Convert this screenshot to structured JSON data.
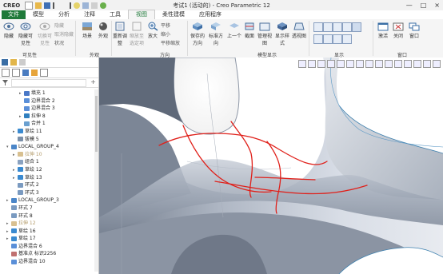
{
  "app": {
    "logo": "CREO",
    "window_title": "考试1 (活动的) - Creo Parametric 12",
    "win_buttons": [
      "—",
      "□",
      "×"
    ]
  },
  "tabs": [
    "文件",
    "模型",
    "分析",
    "注释",
    "工具",
    "视图",
    "柔性建模",
    "应用程序"
  ],
  "active_tab": "视图",
  "ribbon": {
    "visibility": {
      "btn_hide": "隐藏",
      "btn_show": "隐藏可见性",
      "btn_toggle": "切换可见性",
      "small": [
        "隐藏",
        "取消隐藏",
        "状况"
      ],
      "label": "可见性"
    },
    "appearance": {
      "btn_scene": "场景",
      "btn_appearance": "外观",
      "label": "外观"
    },
    "orientation": {
      "btn_refit": "重新调整",
      "btn_zoom_sel": "缩放至选定项",
      "btn_zoom": "放大",
      "small": [
        "平移",
        "缩小",
        "平移缩放"
      ],
      "label": "方向"
    },
    "model_display": {
      "btn_saved_orient": "保存的方向",
      "btn_standard_orient": "标准方向",
      "btn_prev": "上一个",
      "btn_section": "截面",
      "btn_manage_views": "管理视图",
      "btn_display_style": "显示样式",
      "btn_perspective": "透视图",
      "label": "模型显示"
    },
    "show": {
      "label": "显示"
    },
    "window": {
      "btn_activate": "激活",
      "btn_close": "关闭",
      "btn_windows": "窗口",
      "label": "窗口"
    }
  },
  "tree": [
    {
      "label": "填充 1",
      "indent": 3,
      "arrow": "▸",
      "icon": "#4a78c7",
      "dim": false
    },
    {
      "label": "边界混合 2",
      "indent": 3,
      "arrow": "",
      "icon": "#5a8fd8",
      "dim": false
    },
    {
      "label": "边界混合 3",
      "indent": 3,
      "arrow": "",
      "icon": "#5a8fd8",
      "dim": false
    },
    {
      "label": "拉伸 8",
      "indent": 3,
      "arrow": "▸",
      "icon": "#2f7fbf",
      "dim": false
    },
    {
      "label": "合并 1",
      "indent": 3,
      "arrow": "",
      "icon": "#6aa0d0",
      "dim": false
    },
    {
      "label": "草绘 11",
      "indent": 2,
      "arrow": "▸",
      "icon": "#3a8ad0",
      "dim": false
    },
    {
      "label": "拔模 5",
      "indent": 2,
      "arrow": "",
      "icon": "#7a8fa8",
      "dim": false
    },
    {
      "label": "LOCAL_GROUP_4",
      "indent": 1,
      "arrow": "▾",
      "icon": "#4b86c8",
      "dim": false
    },
    {
      "label": "拉伸 10",
      "indent": 2,
      "arrow": "▸",
      "icon": "#d8c090",
      "dim": true
    },
    {
      "label": "组合 1",
      "indent": 2,
      "arrow": "",
      "icon": "#8aa2c0",
      "dim": false
    },
    {
      "label": "草绘 12",
      "indent": 2,
      "arrow": "▸",
      "icon": "#3a8ad0",
      "dim": false
    },
    {
      "label": "草绘 13",
      "indent": 2,
      "arrow": "▸",
      "icon": "#3a8ad0",
      "dim": false
    },
    {
      "label": "环式 2",
      "indent": 2,
      "arrow": "",
      "icon": "#7a9ac0",
      "dim": false
    },
    {
      "label": "环式 3",
      "indent": 2,
      "arrow": "",
      "icon": "#7a9ac0",
      "dim": false
    },
    {
      "label": "LOCAL_GROUP_3",
      "indent": 1,
      "arrow": "▸",
      "icon": "#4b86c8",
      "dim": false
    },
    {
      "label": "环式 7",
      "indent": 1,
      "arrow": "",
      "icon": "#7a9ac0",
      "dim": false
    },
    {
      "label": "环式 8",
      "indent": 1,
      "arrow": "",
      "icon": "#7a9ac0",
      "dim": false
    },
    {
      "label": "拉伸 12",
      "indent": 1,
      "arrow": "▸",
      "icon": "#d8c090",
      "dim": true
    },
    {
      "label": "草绘 16",
      "indent": 1,
      "arrow": "▸",
      "icon": "#3a8ad0",
      "dim": false
    },
    {
      "label": "草绘 17",
      "indent": 1,
      "arrow": "▸",
      "icon": "#3a8ad0",
      "dim": false
    },
    {
      "label": "边界混合 6",
      "indent": 1,
      "arrow": "",
      "icon": "#5a8fd8",
      "dim": false
    },
    {
      "label": "基准点 标识2256",
      "indent": 1,
      "arrow": "",
      "icon": "#c07070",
      "dim": false
    },
    {
      "label": "边界混合 10",
      "indent": 1,
      "arrow": "",
      "icon": "#5a8fd8",
      "dim": false
    }
  ],
  "colors": {
    "file_tab": "#1f7a3a",
    "active_tab_text": "#1f7a3a",
    "annotation": "#e0201a",
    "surface_light": "#dfe3ea",
    "surface_dark": "#8d95a3",
    "edge": "#3c7fae"
  }
}
